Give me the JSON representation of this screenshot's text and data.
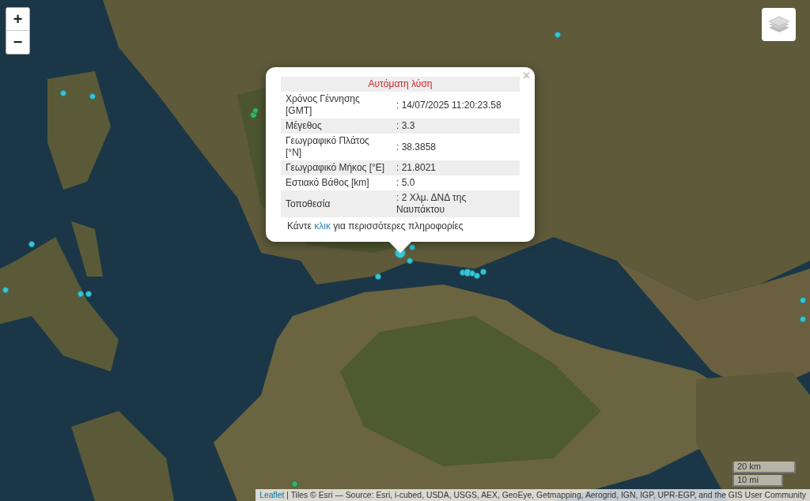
{
  "map_controls": {
    "zoom_in": "+",
    "zoom_out": "−"
  },
  "popup": {
    "close": "×",
    "title": "Αυτόματη λύση",
    "rows": [
      {
        "label": "Χρόνος Γέννησης [GMT]",
        "value": ": 14/07/2025 11:20:23.58"
      },
      {
        "label": "Μέγεθος",
        "value": ": 3.3"
      },
      {
        "label": "Γεωγραφικό Πλάτος [°N]",
        "value": ": 38.3858"
      },
      {
        "label": "Γεωγραφικό Μήκος [°E]",
        "value": ": 21.8021"
      },
      {
        "label": "Εστιακό Βάθος [km]",
        "value": ": 5.0"
      },
      {
        "label": "Τοποθεσία",
        "value": ": 2 Χλμ. ΔΝΔ της Ναυπάκτου"
      }
    ],
    "footer": {
      "before": "Κάντε",
      "link": "κλικ",
      "after": "για περισσότερες πληροφορίες"
    }
  },
  "scale": {
    "metric": "20 km",
    "imperial": "10 mi"
  },
  "attribution": {
    "link": "Leaflet",
    "text": "| Tiles © Esri — Source: Esri, i-cubed, USDA, USGS, AEX, GeoEye, Getmapping, Aerogrid, IGN, IGP, UPR-EGP, and the GIS User Community"
  }
}
